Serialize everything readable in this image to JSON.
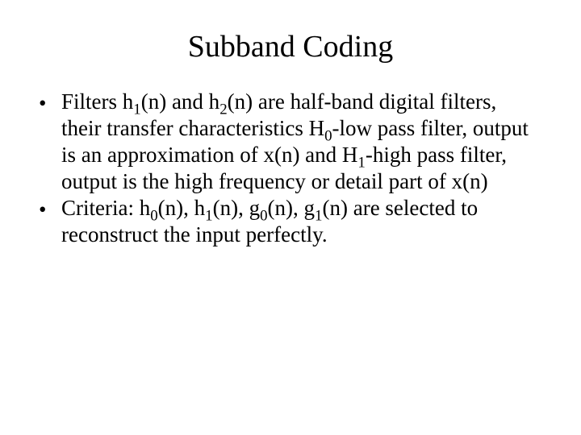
{
  "title": "Subband Coding",
  "bullets": [
    {
      "parts": [
        {
          "t": "Filters h"
        },
        {
          "t": "1",
          "sub": true
        },
        {
          "t": "(n) and h"
        },
        {
          "t": "2",
          "sub": true
        },
        {
          "t": "(n) are half-band digital filters, their transfer characteristics H"
        },
        {
          "t": "0",
          "sub": true
        },
        {
          "t": "-low pass filter, output is an approximation of x(n) and H"
        },
        {
          "t": "1",
          "sub": true
        },
        {
          "t": "-high pass filter, output is the high frequency or detail part of x(n)"
        }
      ]
    },
    {
      "parts": [
        {
          "t": "Criteria: h"
        },
        {
          "t": "0",
          "sub": true
        },
        {
          "t": "(n), h"
        },
        {
          "t": "1",
          "sub": true
        },
        {
          "t": "(n), g"
        },
        {
          "t": "0",
          "sub": true
        },
        {
          "t": "(n), g"
        },
        {
          "t": "1",
          "sub": true
        },
        {
          "t": "(n)  are selected to reconstruct the input perfectly."
        }
      ]
    }
  ],
  "bullet_marker": "•"
}
